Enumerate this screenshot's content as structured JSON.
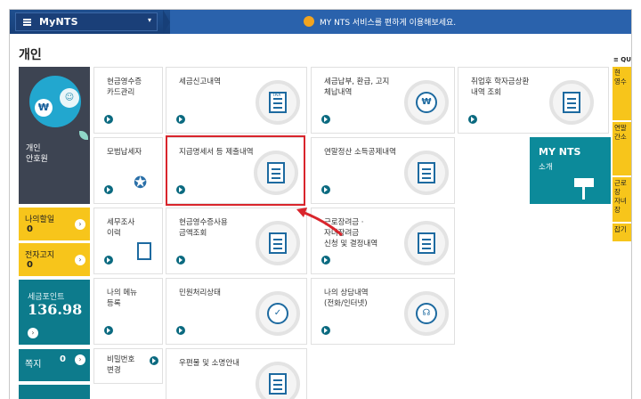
{
  "topbar": {
    "brand": "MyNTS",
    "caret": "▾",
    "notice": "MY NTS 서비스를 편하게 이용해보세요."
  },
  "section_title": "개인",
  "profile": {
    "won_symbol": "₩",
    "smile": "☺",
    "label_line1": "개인",
    "label_line2": "안호원"
  },
  "left_tiles": {
    "due": {
      "label": "나의할일",
      "count": "0"
    },
    "enotice": {
      "label": "전자고지",
      "count": "0"
    },
    "points": {
      "label": "세금포인트",
      "value": "136.98"
    },
    "memo": {
      "label": "쪽지",
      "count": "0"
    }
  },
  "tiles": {
    "cash_receipt_card": "현금영수증\n카드관리",
    "tax_report": "세금신고내역",
    "tax_payment": "세금납부, 환급, 고지\n체납내역",
    "student_loan": "취업후 학자금상환\n내역 조회",
    "model_taxpayer": "모범납세자",
    "payment_statement": "지급명세서 등 제출내역",
    "year_end": "연말정산 소득공제내역",
    "audit": "세무조사\n이력",
    "cash_receipt_use": "현금영수증사용\n금액조회",
    "incentive": "근로장려금 ·\n자녀장려금\n신청 및 결정내역",
    "my_menu": "나의 메뉴\n등록",
    "civil": "민원처리상태",
    "consult": "나의 상담내역\n(전화/인터넷)",
    "password": "비밀번호\n변경",
    "mail": "우편물 및 소명안내"
  },
  "icons": {
    "tax_badge": "TAX",
    "won": "₩"
  },
  "nts": {
    "title": "MY NTS",
    "sub": "소개"
  },
  "quick": {
    "header": "≡ QU",
    "items": [
      "현\n영수",
      "연말\n간소",
      "근로장\n자녀장",
      "잡기"
    ]
  },
  "colors": {
    "topbar": "#1f4f8f",
    "yellow": "#f7c51b",
    "teal": "#0d7b8c",
    "highlight": "#d9252c"
  }
}
